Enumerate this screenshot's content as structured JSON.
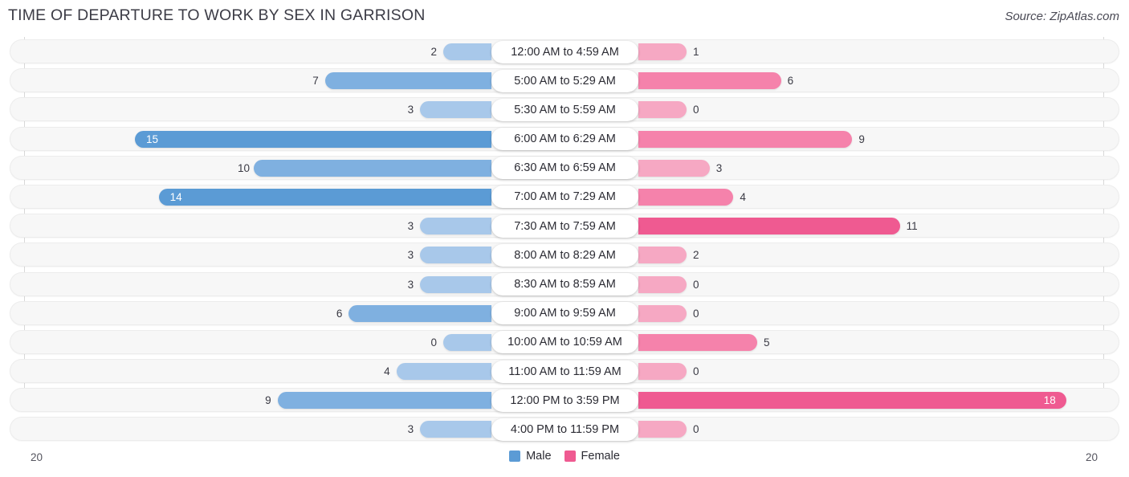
{
  "header": {
    "title": "TIME OF DEPARTURE TO WORK BY SEX IN GARRISON",
    "source": "Source: ZipAtlas.com"
  },
  "axis": {
    "left_end_label": "20",
    "right_end_label": "20",
    "max": 20
  },
  "legend": [
    {
      "label": "Male",
      "color": "#5b9bd5"
    },
    {
      "label": "Female",
      "color": "#ef5a91"
    }
  ],
  "colors": {
    "male_light": "#a8c8ea",
    "male_mid": "#7fb0e0",
    "male_strong": "#5b9bd5",
    "female_light": "#f6a8c3",
    "female_mid": "#f582ab",
    "female_strong": "#ef5a91",
    "track": "#f7f7f7",
    "axis": "#d8d8d8"
  },
  "chart_data": {
    "type": "bar",
    "title": "TIME OF DEPARTURE TO WORK BY SEX IN GARRISON",
    "subtitle": "Source: ZipAtlas.com",
    "orientation": "horizontal-diverging",
    "xlabel": "",
    "ylabel": "",
    "xlim": [
      20,
      20
    ],
    "grid": false,
    "legend_position": "bottom-center",
    "categories": [
      "12:00 AM to 4:59 AM",
      "5:00 AM to 5:29 AM",
      "5:30 AM to 5:59 AM",
      "6:00 AM to 6:29 AM",
      "6:30 AM to 6:59 AM",
      "7:00 AM to 7:29 AM",
      "7:30 AM to 7:59 AM",
      "8:00 AM to 8:29 AM",
      "8:30 AM to 8:59 AM",
      "9:00 AM to 9:59 AM",
      "10:00 AM to 10:59 AM",
      "11:00 AM to 11:59 AM",
      "12:00 PM to 3:59 PM",
      "4:00 PM to 11:59 PM"
    ],
    "series": [
      {
        "name": "Male",
        "values": [
          2,
          7,
          3,
          15,
          10,
          14,
          3,
          3,
          3,
          6,
          0,
          4,
          9,
          3
        ]
      },
      {
        "name": "Female",
        "values": [
          1,
          6,
          0,
          9,
          3,
          4,
          11,
          2,
          0,
          0,
          5,
          0,
          18,
          0
        ]
      }
    ]
  },
  "rows": [
    {
      "category": "12:00 AM to 4:59 AM",
      "male": "2",
      "female": "1"
    },
    {
      "category": "5:00 AM to 5:29 AM",
      "male": "7",
      "female": "6"
    },
    {
      "category": "5:30 AM to 5:59 AM",
      "male": "3",
      "female": "0"
    },
    {
      "category": "6:00 AM to 6:29 AM",
      "male": "15",
      "female": "9"
    },
    {
      "category": "6:30 AM to 6:59 AM",
      "male": "10",
      "female": "3"
    },
    {
      "category": "7:00 AM to 7:29 AM",
      "male": "14",
      "female": "4"
    },
    {
      "category": "7:30 AM to 7:59 AM",
      "male": "3",
      "female": "11"
    },
    {
      "category": "8:00 AM to 8:29 AM",
      "male": "3",
      "female": "2"
    },
    {
      "category": "8:30 AM to 8:59 AM",
      "male": "3",
      "female": "0"
    },
    {
      "category": "9:00 AM to 9:59 AM",
      "male": "6",
      "female": "0"
    },
    {
      "category": "10:00 AM to 10:59 AM",
      "male": "0",
      "female": "5"
    },
    {
      "category": "11:00 AM to 11:59 AM",
      "male": "4",
      "female": "0"
    },
    {
      "category": "12:00 PM to 3:59 PM",
      "male": "9",
      "female": "18"
    },
    {
      "category": "4:00 PM to 11:59 PM",
      "male": "3",
      "female": "0"
    }
  ]
}
